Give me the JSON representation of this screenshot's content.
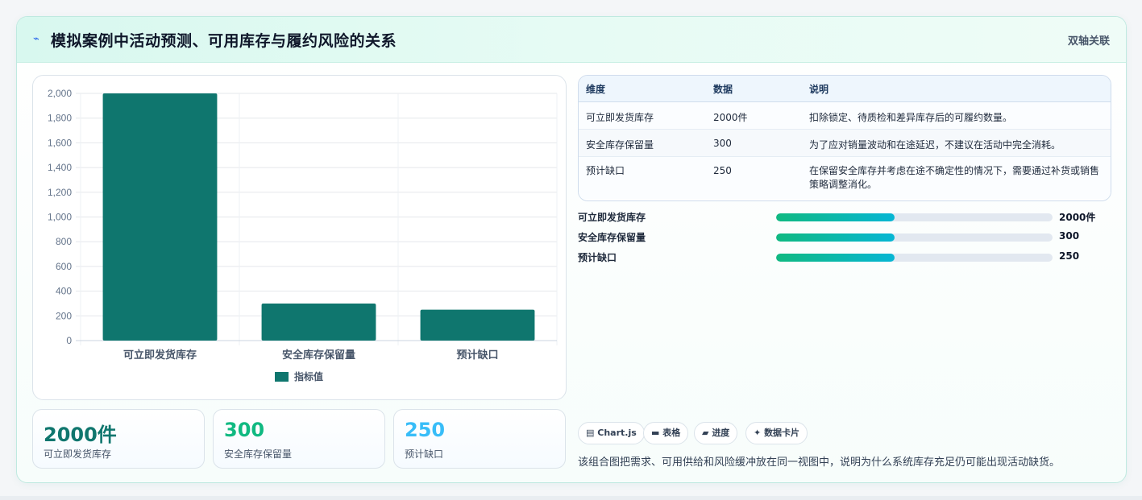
{
  "header": {
    "title": "模拟案例中活动预测、可用库存与履约风险的关系",
    "icon": "pulse-icon",
    "tag": "双轴关联"
  },
  "chart_data": {
    "type": "bar",
    "categories": [
      "可立即发货库存",
      "安全库存保留量",
      "预计缺口"
    ],
    "series": [
      {
        "name": "指标值",
        "values": [
          2000,
          300,
          250
        ],
        "color": "#0f766e"
      }
    ],
    "yticks": [
      "0",
      "200",
      "400",
      "600",
      "800",
      "1,000",
      "1,200",
      "1,400",
      "1,600",
      "1,800",
      "2,000"
    ],
    "ylim": [
      0,
      2000
    ],
    "grid": true,
    "legend": "bottom"
  },
  "kpis": [
    {
      "value": "2000件",
      "label": "可立即发货库存",
      "color": "#0f766e"
    },
    {
      "value": "300",
      "label": "安全库存保留量",
      "color": "#10b981"
    },
    {
      "value": "250",
      "label": "预计缺口",
      "color": "#38bdf8"
    }
  ],
  "table": {
    "headers": [
      "维度",
      "数据",
      "说明"
    ],
    "rows": [
      [
        "可立即发货库存",
        "2000件",
        "扣除锁定、待质检和差异库存后的可履约数量。"
      ],
      [
        "安全库存保留量",
        "300",
        "为了应对销量波动和在途延迟，不建议在活动中完全消耗。"
      ],
      [
        "预计缺口",
        "250",
        "在保留安全库存并考虑在途不确定性的情况下，需要通过补货或销售策略调整消化。"
      ]
    ]
  },
  "progress": [
    {
      "label": "可立即发货库存",
      "value": "2000件",
      "fraction": 0.43
    },
    {
      "label": "安全库存保留量",
      "value": "300",
      "fraction": 0.43
    },
    {
      "label": "预计缺口",
      "value": "250",
      "fraction": 0.43
    }
  ],
  "chips": [
    {
      "label": "Chart.js",
      "glyph": "▤",
      "icon": "chart-icon"
    },
    {
      "label": "表格",
      "glyph": "▬",
      "icon": "table-icon"
    },
    {
      "label": "进度",
      "glyph": "▰",
      "icon": "progress-icon"
    },
    {
      "label": "数据卡片",
      "glyph": "✦",
      "icon": "card-icon"
    }
  ],
  "note": "该组合图把需求、可用供给和风险缓冲放在同一视图中，说明为什么系统库存充足仍可能出现活动缺货。"
}
